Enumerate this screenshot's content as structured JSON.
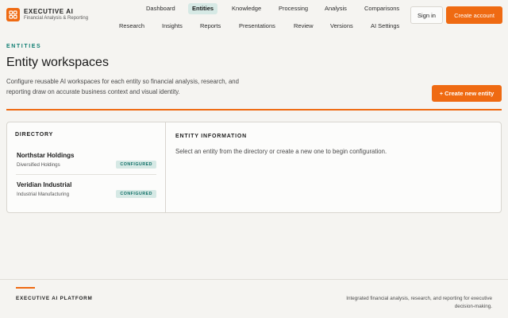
{
  "brand": {
    "name": "EXECUTIVE AI",
    "subtitle": "Financial Analysis & Reporting"
  },
  "nav": {
    "row1": [
      "Dashboard",
      "Entities",
      "Knowledge",
      "Processing",
      "Analysis",
      "Comparisons"
    ],
    "row2": [
      "Research",
      "Insights",
      "Reports",
      "Presentations",
      "Review",
      "Versions",
      "AI Settings"
    ],
    "active": "Entities"
  },
  "auth": {
    "sign_in": "Sign in",
    "create_account": "Create account"
  },
  "hero": {
    "eyebrow": "ENTITIES",
    "title": "Entity workspaces",
    "description": "Configure reusable AI workspaces for each entity so financial analysis, research, and reporting draw on accurate business context and visual identity.",
    "create_button": "+ Create new entity"
  },
  "directory": {
    "label": "DIRECTORY",
    "entities": [
      {
        "name": "Northstar Holdings",
        "sector": "Diversified Holdings",
        "status": "CONFIGURED"
      },
      {
        "name": "Veridian Industrial",
        "sector": "Industrial Manufacturing",
        "status": "CONFIGURED"
      }
    ]
  },
  "entity_info": {
    "label": "ENTITY INFORMATION",
    "empty_message": "Select an entity from the directory or create a new one to begin configuration."
  },
  "footer": {
    "brand": "EXECUTIVE AI PLATFORM",
    "tagline": "Integrated financial analysis, research, and reporting for executive decision-making."
  },
  "colors": {
    "accent": "#ef6a12",
    "teal": "#0f7d72",
    "badge_bg": "#d6e9e5",
    "background": "#f5f4f1"
  }
}
